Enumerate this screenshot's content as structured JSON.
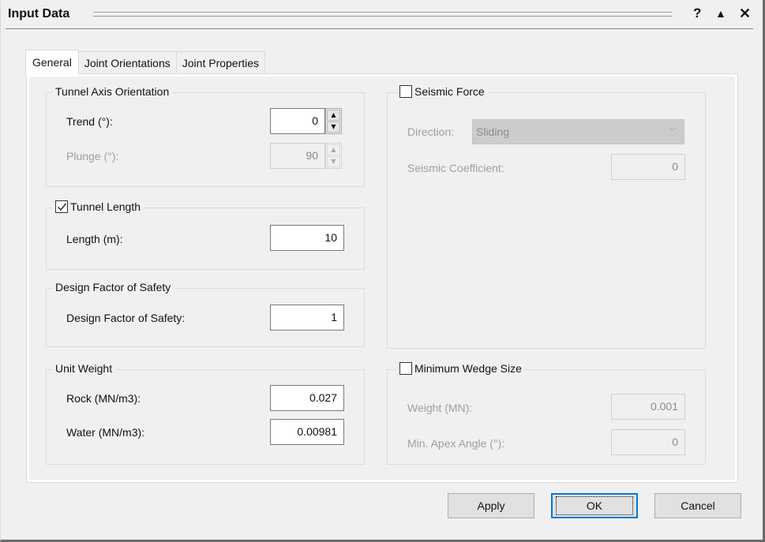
{
  "window": {
    "title": "Input Data",
    "controls": {
      "help": "?",
      "collapse": "▲",
      "close": "✕"
    }
  },
  "tabs": [
    {
      "label": "General",
      "active": true
    },
    {
      "label": "Joint Orientations",
      "active": false
    },
    {
      "label": "Joint Properties",
      "active": false
    }
  ],
  "general": {
    "tunnel_axis": {
      "title": "Tunnel Axis Orientation",
      "trend": {
        "label": "Trend (°):",
        "value": "0",
        "enabled": true
      },
      "plunge": {
        "label": "Plunge (°):",
        "value": "90",
        "enabled": false
      }
    },
    "tunnel_length": {
      "title": "Tunnel Length",
      "checked": true,
      "length": {
        "label": "Length (m):",
        "value": "10"
      }
    },
    "design_fos": {
      "title": "Design Factor of Safety",
      "fos": {
        "label": "Design Factor of Safety:",
        "value": "1"
      }
    },
    "unit_weight": {
      "title": "Unit Weight",
      "rock": {
        "label": "Rock (MN/m3):",
        "value": "0.027"
      },
      "water": {
        "label": "Water (MN/m3):",
        "value": "0.00981"
      }
    },
    "seismic_force": {
      "title": "Seismic Force",
      "checked": false,
      "direction": {
        "label": "Direction:",
        "value": "Sliding",
        "enabled": false
      },
      "coefficient": {
        "label": "Seismic Coefficient:",
        "value": "0",
        "enabled": false
      }
    },
    "min_wedge": {
      "title": "Minimum Wedge Size",
      "checked": false,
      "weight": {
        "label": "Weight (MN):",
        "value": "0.001",
        "enabled": false
      },
      "apex": {
        "label": "Min. Apex Angle (°):",
        "value": "0",
        "enabled": false
      }
    }
  },
  "buttons": {
    "apply": "Apply",
    "ok": "OK",
    "cancel": "Cancel"
  },
  "colors": {
    "focus_accent": "#0078d7",
    "dialog_bg": "#f0f0f0",
    "disabled_text": "#9f9f9f"
  }
}
